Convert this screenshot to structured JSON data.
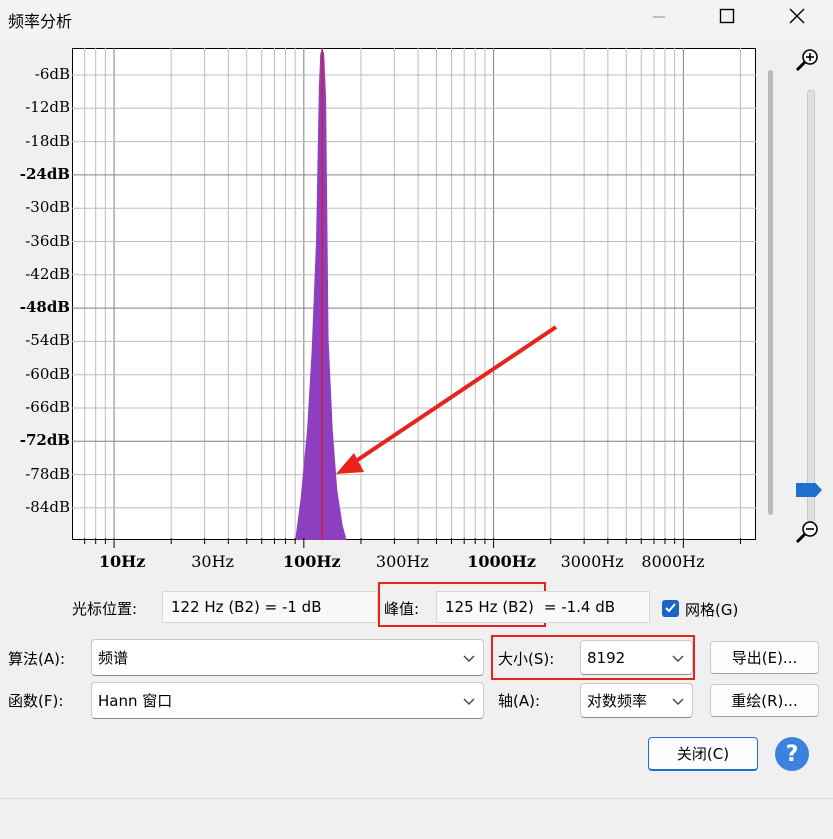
{
  "window": {
    "title": "频率分析",
    "minimize_icon": "minimize-icon",
    "maximize_icon": "maximize-icon",
    "close_icon": "close-icon"
  },
  "plot": {
    "y_labels": [
      {
        "text": "-6dB",
        "bold": false
      },
      {
        "text": "-12dB",
        "bold": false
      },
      {
        "text": "-18dB",
        "bold": false
      },
      {
        "text": "-24dB",
        "bold": true
      },
      {
        "text": "-30dB",
        "bold": false
      },
      {
        "text": "-36dB",
        "bold": false
      },
      {
        "text": "-42dB",
        "bold": false
      },
      {
        "text": "-48dB",
        "bold": true
      },
      {
        "text": "-54dB",
        "bold": false
      },
      {
        "text": "-60dB",
        "bold": false
      },
      {
        "text": "-66dB",
        "bold": false
      },
      {
        "text": "-72dB",
        "bold": true
      },
      {
        "text": "-78dB",
        "bold": false
      },
      {
        "text": "-84dB",
        "bold": false
      }
    ],
    "x_labels": [
      {
        "text": "10Hz",
        "bold": true
      },
      {
        "text": "30Hz",
        "bold": false
      },
      {
        "text": "100Hz",
        "bold": true
      },
      {
        "text": "300Hz",
        "bold": false
      },
      {
        "text": "1000Hz",
        "bold": true
      },
      {
        "text": "3000Hz",
        "bold": false
      },
      {
        "text": "8000Hz",
        "bold": false
      }
    ],
    "spectrum_color": "#8e3fc0",
    "cursor_color": "#d0203a",
    "annotation_color": "#e8231c"
  },
  "readout": {
    "cursor_label": "光标位置:",
    "cursor_value": "122 Hz (B2) = -1 dB",
    "peak_label": "峰值:",
    "peak_value_hz": "125 Hz (B2)",
    "peak_value_db": "= -1.4 dB",
    "grid_label": "网格(G)",
    "grid_checked": true
  },
  "controls": {
    "algorithm_label": "算法(A):",
    "algorithm_value": "频谱",
    "size_label": "大小(S):",
    "size_value": "8192",
    "export_button": "导出(E)...",
    "function_label": "函数(F):",
    "function_value": "Hann 窗口",
    "axis_label": "轴(A):",
    "axis_value": "对数频率",
    "redraw_button": "重绘(R)...",
    "close_button": "关闭(C)",
    "help_button": "?"
  },
  "zoom": {
    "zoom_in_icon": "zoom-in-icon",
    "zoom_out_icon": "zoom-out-icon"
  }
}
